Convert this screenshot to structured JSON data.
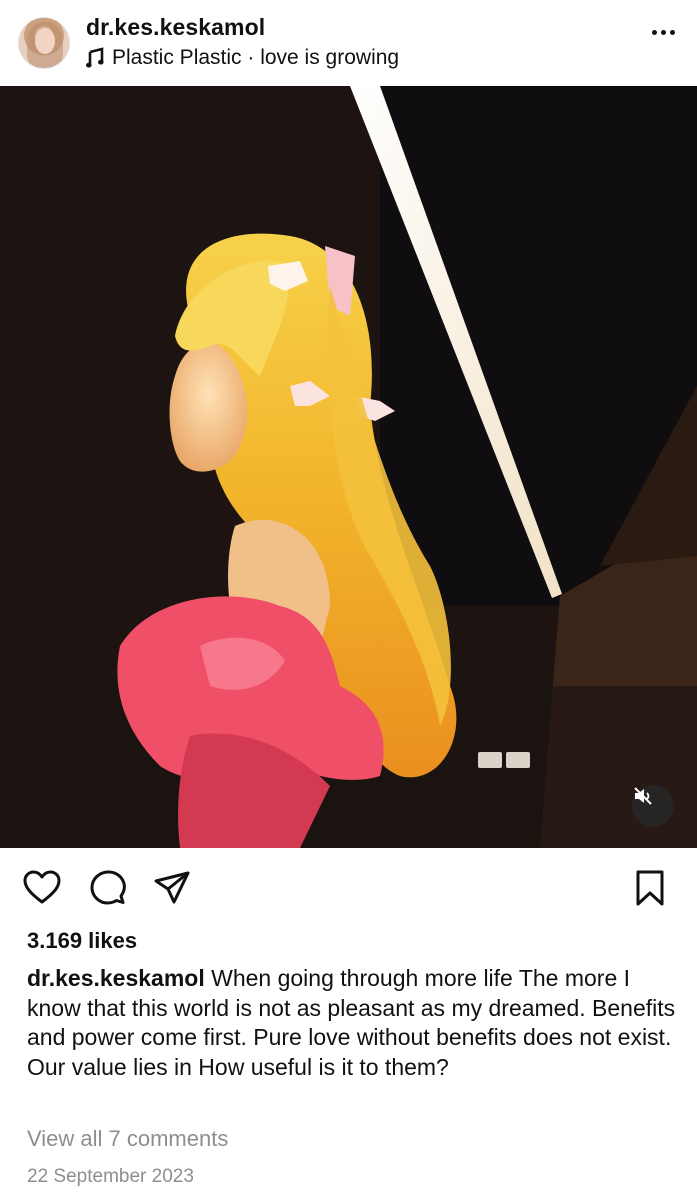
{
  "post": {
    "username": "dr.kes.keskamol",
    "music": "Plastic Plastic · love is growing",
    "likes": "3.169 likes",
    "caption_user": "dr.kes.keskamol",
    "caption_text": " When going through more life The more I know that this world is not as pleasant as my dreamed. Benefits and power come first. Pure love without benefits does not exist. Our value lies in How useful is it to them?",
    "comments_link": "View all 7 comments",
    "date": "22 September 2023"
  },
  "icons": {
    "music": "music-note-icon",
    "more": "more-options-icon",
    "like": "heart-icon",
    "comment": "comment-icon",
    "share": "share-icon",
    "save": "bookmark-icon",
    "mute": "muted-speaker-icon"
  },
  "colors": {
    "text": "#111111",
    "muted_text": "#8e8e8e",
    "background": "#ffffff"
  }
}
